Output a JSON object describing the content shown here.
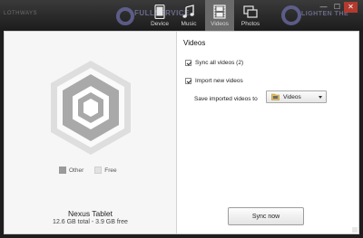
{
  "topbar": {
    "bg_left_text": "LOTHWAYS",
    "bg_mid_text": "FULLSERVICE",
    "bg_right_text": "LIGHTEN THE",
    "tabs": [
      {
        "label": "Device",
        "icon": "tablet-icon"
      },
      {
        "label": "Music",
        "icon": "music-note-icon"
      },
      {
        "label": "Videos",
        "icon": "film-icon",
        "selected": true
      },
      {
        "label": "Photos",
        "icon": "photos-icon"
      }
    ],
    "window_controls": {
      "minimize": "—",
      "maximize": "☐",
      "close": "✕"
    }
  },
  "device": {
    "legend": [
      {
        "label": "Other",
        "color": "#9a9a9a"
      },
      {
        "label": "Free",
        "color": "#e2e2e2"
      }
    ],
    "name": "Nexus Tablet",
    "storage": "12.6 GB total - 3.9 GB free"
  },
  "videos": {
    "title": "Videos",
    "sync_all_label": "Sync all videos (2)",
    "sync_all_checked": true,
    "import_new_label": "Import new videos",
    "import_new_checked": true,
    "save_label": "Save imported videos to",
    "folder_value": "Videos",
    "sync_button_label": "Sync now"
  },
  "colors": {
    "topbar": "#2a2a2a",
    "selected_tab": "#6a6a6a",
    "close": "#b23a2e"
  }
}
